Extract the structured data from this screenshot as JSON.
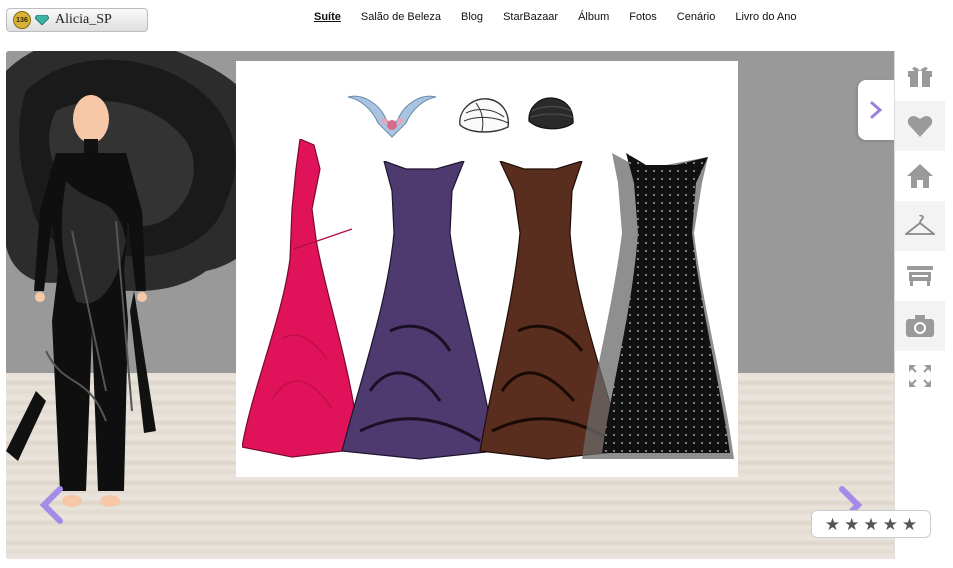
{
  "user": {
    "level": "136",
    "name": "Alicia_SP"
  },
  "nav": {
    "items": [
      "Suíte",
      "Salão de Beleza",
      "Blog",
      "StarBazaar",
      "Álbum",
      "Fotos",
      "Cenário",
      "Livro do Ano"
    ],
    "active": "Suíte"
  },
  "sidebar": {
    "icons": [
      "gift-icon",
      "heart-icon",
      "home-icon",
      "hanger-icon",
      "shop-icon",
      "camera-icon",
      "fullscreen-icon"
    ]
  },
  "rating": {
    "stars": 5,
    "star_char": "★"
  },
  "colors": {
    "accent": "#9b7fe0",
    "gown_pink": "#e0135a",
    "gown_purple": "#4e3a6e",
    "gown_brown": "#5a2e1e",
    "gown_black": "#111111"
  }
}
